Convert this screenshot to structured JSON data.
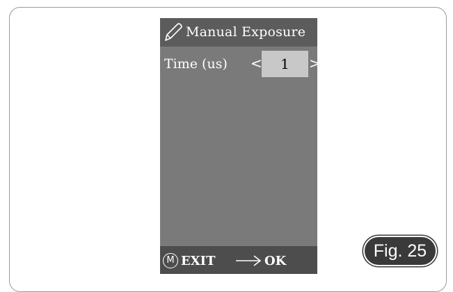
{
  "screen": {
    "title_icon": "pencil-icon",
    "title": "Manual Exposure",
    "time_row": {
      "label": "Time (us)",
      "left_arrow": "<",
      "value": "1",
      "right_arrow": ">"
    },
    "bottom_bar": {
      "exit_icon_letter": "M",
      "exit_label": "EXIT",
      "ok_icon": "arrow-right-icon",
      "ok_label": "OK"
    },
    "colors": {
      "panel": "#7a7a7a",
      "title_bar": "#5c5c5c",
      "bottom_bar": "#4d4d4d",
      "value_box": "#c8c8c8"
    }
  },
  "figure_label": "Fig. 25"
}
